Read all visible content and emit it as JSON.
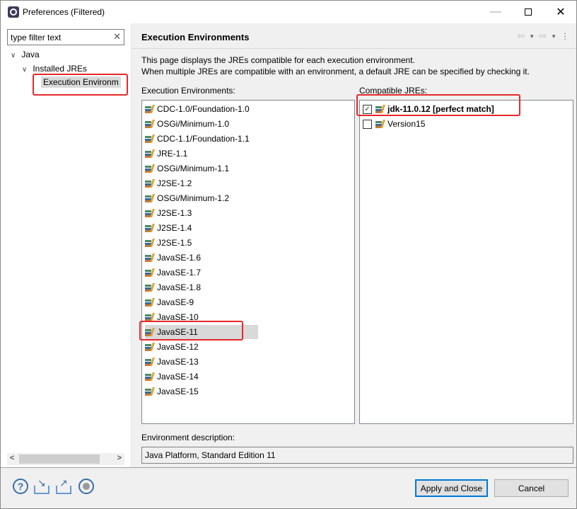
{
  "window": {
    "title": "Preferences (Filtered)",
    "controls": {
      "minimize": "—",
      "close": "✕"
    }
  },
  "sidebar": {
    "filter_value": "type filter text",
    "filter_clear": "✕",
    "tree": [
      {
        "label": "Java",
        "expanded": true,
        "level": 0
      },
      {
        "label": "Installed JREs",
        "expanded": true,
        "level": 1
      },
      {
        "label": "Execution Environm",
        "selected": true,
        "level": 2
      }
    ],
    "scroll_left": "<",
    "scroll_right": ">"
  },
  "page": {
    "title": "Execution Environments",
    "nav": {
      "back": "⇦",
      "forward": "⇨",
      "dropdown": "▼",
      "menu": "⋮"
    },
    "description_line1": "This page displays the JREs compatible for each execution environment.",
    "description_line2": "When multiple JREs are compatible with an environment, a default JRE can be specified by checking it.",
    "environments_label": "Execution Environments:",
    "compatible_label": "Compatible JREs:",
    "environments": [
      "CDC-1.0/Foundation-1.0",
      "OSGi/Minimum-1.0",
      "CDC-1.1/Foundation-1.1",
      "JRE-1.1",
      "OSGi/Minimum-1.1",
      "J2SE-1.2",
      "OSGi/Minimum-1.2",
      "J2SE-1.3",
      "J2SE-1.4",
      "J2SE-1.5",
      "JavaSE-1.6",
      "JavaSE-1.7",
      "JavaSE-1.8",
      "JavaSE-9",
      "JavaSE-10",
      "JavaSE-11",
      "JavaSE-12",
      "JavaSE-13",
      "JavaSE-14",
      "JavaSE-15"
    ],
    "selected_environment": "JavaSE-11",
    "compatible_jres": [
      {
        "label": "jdk-11.0.12 [perfect match]",
        "checked": true,
        "check_glyph": "✓"
      },
      {
        "label": "Version15",
        "checked": false,
        "check_glyph": ""
      }
    ],
    "env_description_label": "Environment description:",
    "env_description_value": "Java Platform, Standard Edition 11"
  },
  "footer": {
    "help_glyph": "?",
    "import_glyph": "↘",
    "export_glyph": "↗",
    "apply_label": "Apply and Close",
    "cancel_label": "Cancel"
  },
  "annotation_color": "#e8282a"
}
